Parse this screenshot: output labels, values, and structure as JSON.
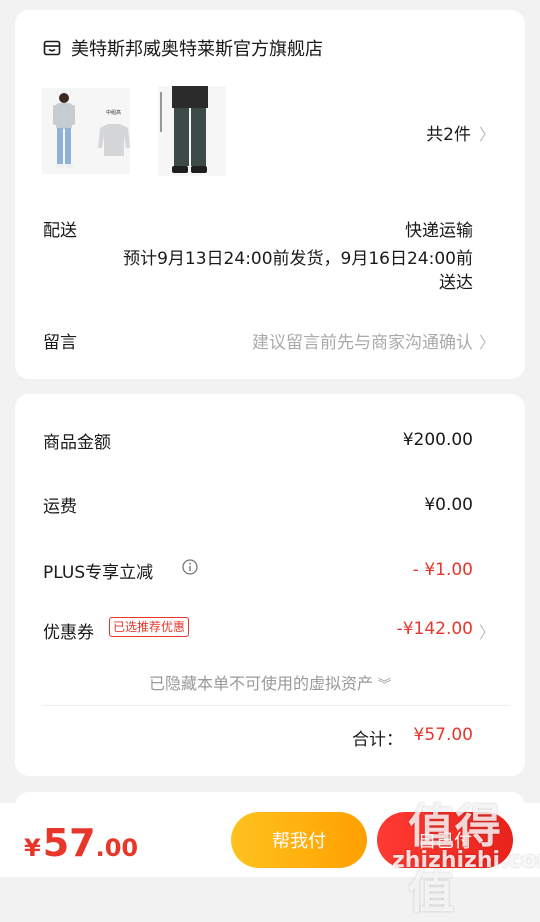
{
  "shop": {
    "name": "美特斯邦威奥特莱斯官方旗舰店",
    "icon": "shop-icon"
  },
  "products": {
    "count_text": "共2件",
    "items": [
      {
        "name": "sweater-product",
        "image_text": "中组高"
      },
      {
        "name": "jeans-product",
        "image_text": ""
      }
    ]
  },
  "delivery": {
    "label": "配送",
    "method": "快递运输",
    "estimate_line1": "预计9月13日24:00前发货，9月16日24:00前",
    "estimate_line2": "送达"
  },
  "message": {
    "label": "留言",
    "placeholder": "建议留言前先与商家沟通确认"
  },
  "pricing": {
    "goods_label": "商品金额",
    "goods_value": "¥200.00",
    "shipping_label": "运费",
    "shipping_value": "¥0.00",
    "plus_label": "PLUS专享立减",
    "plus_value": "- ¥1.00",
    "coupon_label": "优惠券",
    "coupon_tag": "已选推荐优惠",
    "coupon_value": "-¥142.00",
    "hidden_assets": "已隐藏本单不可使用的虚拟资产",
    "total_label": "合计：",
    "total_value": "¥57.00"
  },
  "bottom": {
    "currency": "¥",
    "amount_int": "57",
    "amount_dec": ".00",
    "help_pay_label": "帮我付",
    "pay_label": "自己付"
  },
  "watermark": {
    "text": "值得值",
    "site": "zhizhizhi.com"
  },
  "colors": {
    "accent_red": "#e8362b",
    "help_button": "#ffb000",
    "pay_button": "#ff3a33",
    "background": "#f2f2f2"
  }
}
